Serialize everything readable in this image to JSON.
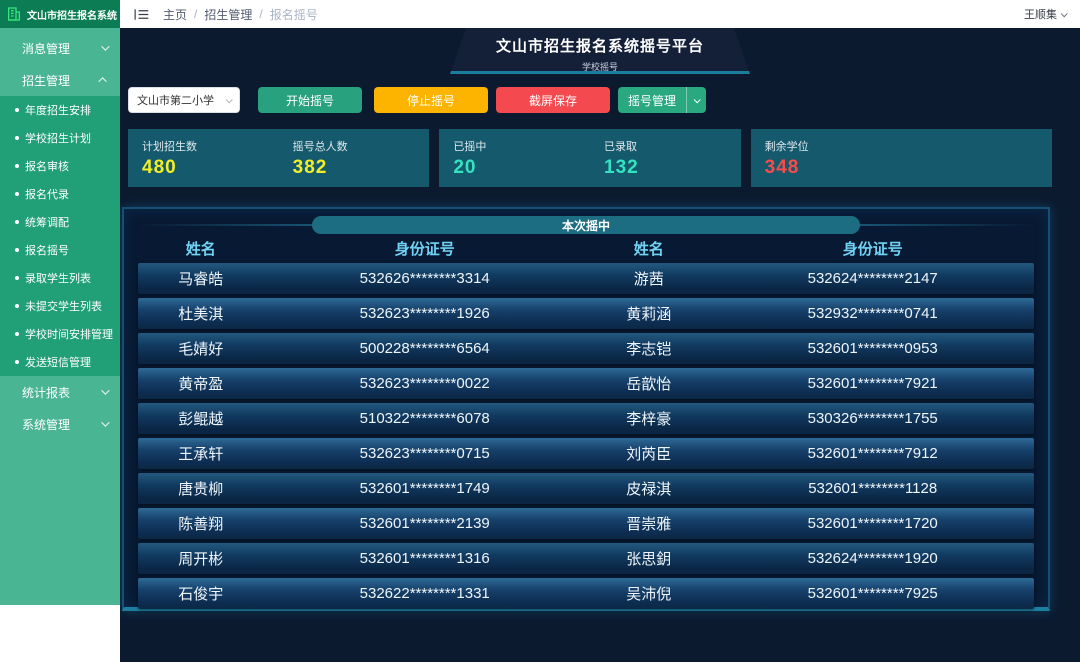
{
  "app": {
    "logo_title": "文山市招生报名系统"
  },
  "sidebar": {
    "groups": [
      {
        "label": "消息管理"
      },
      {
        "label": "招生管理"
      },
      {
        "label": "统计报表"
      },
      {
        "label": "系统管理"
      }
    ],
    "submenu": [
      "年度招生安排",
      "学校招生计划",
      "报名审核",
      "报名代录",
      "统筹调配",
      "报名摇号",
      "录取学生列表",
      "未提交学生列表",
      "学校时间安排管理",
      "发送短信管理"
    ]
  },
  "topbar": {
    "breadcrumb": [
      "主页",
      "招生管理",
      "报名摇号"
    ],
    "separator": "/",
    "user": "王顺集"
  },
  "banner": {
    "title": "文山市招生报名系统摇号平台",
    "subtitle": "学校摇号"
  },
  "controls": {
    "school": "文山市第二小学",
    "start": "开始摇号",
    "stop": "停止摇号",
    "screenshot": "截屏保存",
    "manage": "摇号管理"
  },
  "stats": {
    "plan": {
      "label": "计划招生数",
      "value": "480",
      "color": "#f2ee27"
    },
    "total": {
      "label": "摇号总人数",
      "value": "382",
      "color": "#f2ee27"
    },
    "drawn": {
      "label": "已摇中",
      "value": "20",
      "color": "#36e3c0"
    },
    "admitted": {
      "label": "已录取",
      "value": "132",
      "color": "#36e3c0"
    },
    "remaining": {
      "label": "剩余学位",
      "value": "348",
      "color": "#fa4b4b"
    }
  },
  "table": {
    "title": "本次摇中",
    "headers": [
      "姓名",
      "身份证号",
      "姓名",
      "身份证号"
    ],
    "rows": [
      [
        "马睿皓",
        "532626********3314",
        "游茜",
        "532624********2147"
      ],
      [
        "杜美淇",
        "532623********1926",
        "黄莉涵",
        "532932********0741"
      ],
      [
        "毛婧好",
        "500228********6564",
        "李志铠",
        "532601********0953"
      ],
      [
        "黄帝盈",
        "532623********0022",
        "岳歆怡",
        "532601********7921"
      ],
      [
        "彭鲲越",
        "510322********6078",
        "李梓豪",
        "530326********1755"
      ],
      [
        "王承轩",
        "532623********0715",
        "刘芮臣",
        "532601********7912"
      ],
      [
        "唐贵柳",
        "532601********1749",
        "皮禄淇",
        "532601********1128"
      ],
      [
        "陈善翔",
        "532601********2139",
        "晋崇雅",
        "532601********1720"
      ],
      [
        "周开彬",
        "532601********1316",
        "张思鈅",
        "532624********1920"
      ],
      [
        "石俊宇",
        "532622********1331",
        "吴沛倪",
        "532601********7925"
      ]
    ]
  },
  "colors": {
    "sidebar_green": "#49b593",
    "submenu_green": "#21a077",
    "logo_green": "#0b7c54",
    "content_navy": "#0c1a30",
    "card_teal": "#14596c",
    "accent_green": "#27a17e",
    "warn_yellow": "#fdb400",
    "danger_red": "#f4494e",
    "header_cyan": "#70d3f4"
  }
}
